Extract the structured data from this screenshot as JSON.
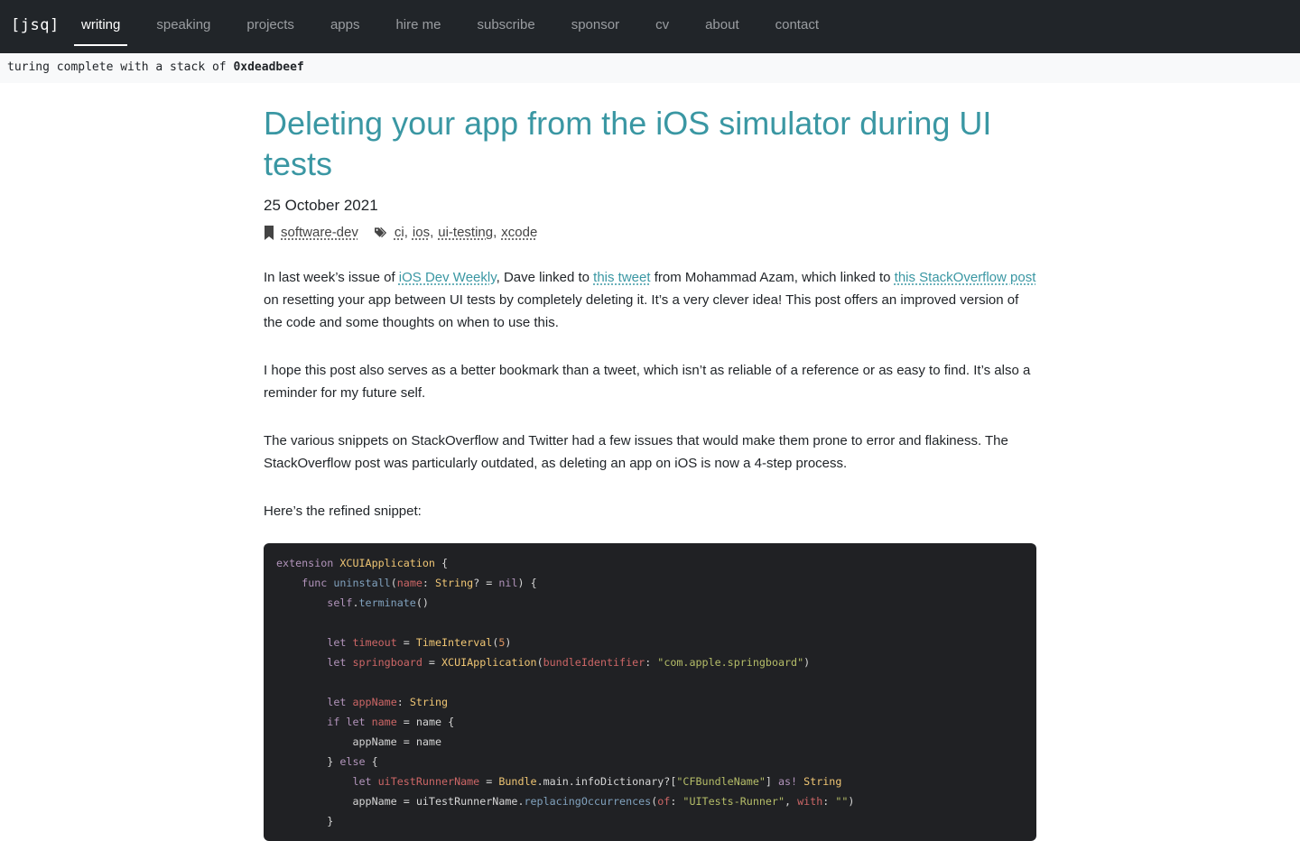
{
  "nav": {
    "brand": "[jsq]",
    "items": [
      {
        "label": "writing"
      },
      {
        "label": "speaking"
      },
      {
        "label": "projects"
      },
      {
        "label": "apps"
      },
      {
        "label": "hire me"
      },
      {
        "label": "subscribe"
      },
      {
        "label": "sponsor"
      },
      {
        "label": "cv"
      },
      {
        "label": "about"
      },
      {
        "label": "contact"
      }
    ]
  },
  "tagline": {
    "prefix": "turing complete with a stack of ",
    "emphasis": "0xdeadbeef"
  },
  "article": {
    "title": "Deleting your app from the iOS simulator during UI tests",
    "date": "25 October 2021",
    "category": "software-dev",
    "tags": [
      "ci",
      "ios",
      "ui-testing",
      "xcode"
    ],
    "paragraphs": {
      "p1": {
        "t1": "In last week’s issue of ",
        "l1": "iOS Dev Weekly",
        "t2": ", Dave linked to ",
        "l2": "this tweet",
        "t3": " from Mohammad Azam, which linked to ",
        "l3": "this StackOverflow post",
        "t4": " on resetting your app between UI tests by completely deleting it. It’s a very clever idea! This post offers an improved version of the code and some thoughts on when to use this."
      },
      "p2": "I hope this post also serves as a better bookmark than a tweet, which isn’t as reliable of a reference or as easy to find. It’s also a reminder for my future self.",
      "p3": "The various snippets on StackOverflow and Twitter had a few issues that would make them prone to error and flakiness. The StackOverflow post was particularly outdated, as deleting an app on iOS is now a 4-step process.",
      "p4": "Here’s the refined snippet:"
    }
  },
  "code": {
    "tokens": {
      "extension": "extension",
      "XCUIApplication": "XCUIApplication",
      "func": "func",
      "uninstall": "uninstall",
      "name": "name",
      "String": "String",
      "nil": "nil",
      "self": "self",
      "terminate": "terminate",
      "let": "let",
      "timeout": "timeout",
      "TimeInterval": "TimeInterval",
      "five": "5",
      "springboard": "springboard",
      "bundleIdentifier": "bundleIdentifier",
      "springboardId": "\"com.apple.springboard\"",
      "appName": "appName",
      "if": "if",
      "else": "else",
      "uiTestRunnerName": "uiTestRunnerName",
      "Bundle": "Bundle",
      "mainInfo": ".main.infoDictionary?[",
      "CFBundleName": "\"CFBundleName\"",
      "as": "as!",
      "replacing": "replacingOccurrences",
      "of": "of",
      "runnerStr": "\"UITests-Runner\"",
      "with": "with",
      "empty": "\"\""
    }
  }
}
